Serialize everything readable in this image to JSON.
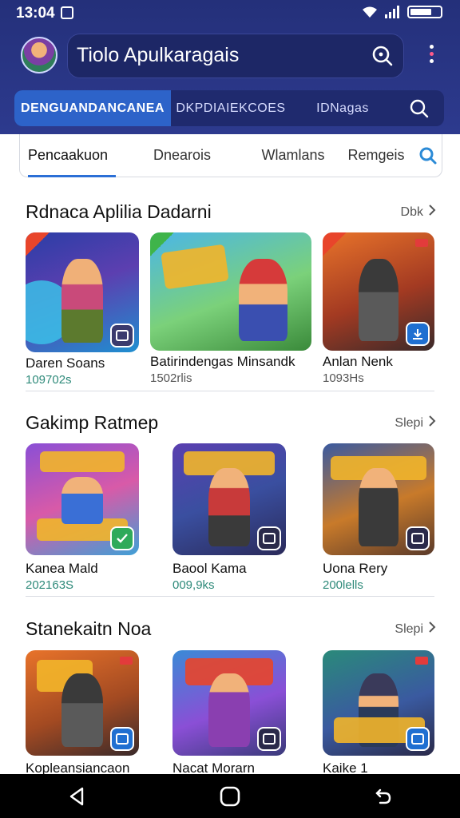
{
  "status_bar": {
    "time": "13:04"
  },
  "header": {
    "title": "Tiolo Apulkaragais",
    "tabs": [
      "DENGUANDANCANEA",
      "DKPDIAIEKCOES",
      "IDNagas"
    ]
  },
  "sub_tabs": [
    "Pencaakuon",
    "Dnearois",
    "Wlamlans",
    "Remgeis"
  ],
  "sections": [
    {
      "title": "Rdnaca Aplilia Dadarni",
      "more": "Dbk",
      "cards": [
        {
          "name": "Daren Soans",
          "meta": "109702s"
        },
        {
          "name": "Batirindengas Minsandk",
          "meta": "1502rlis"
        },
        {
          "name": "Anlan Nenk",
          "meta": "1093Hs"
        }
      ]
    },
    {
      "title": "Gakimp Ratmep",
      "more": "Slepi",
      "cards": [
        {
          "name": "Kanea Mald",
          "meta": "202163S"
        },
        {
          "name": "Baool Kama",
          "meta": "009,9ks"
        },
        {
          "name": "Uona Rery",
          "meta": "200lells"
        }
      ]
    },
    {
      "title": "Stanekaitn Noa",
      "more": "Slepi",
      "cards": [
        {
          "name": "Kopleansiancaon",
          "meta": ""
        },
        {
          "name": "Nacat Morarn",
          "meta": ""
        },
        {
          "name": "Kaike 1",
          "meta": ""
        }
      ]
    }
  ],
  "colors": {
    "header_bg": "#2d3a8e",
    "active_tab": "#2d63c9",
    "accent": "#2b6fd6",
    "meta_text": "#2e8a7a"
  }
}
